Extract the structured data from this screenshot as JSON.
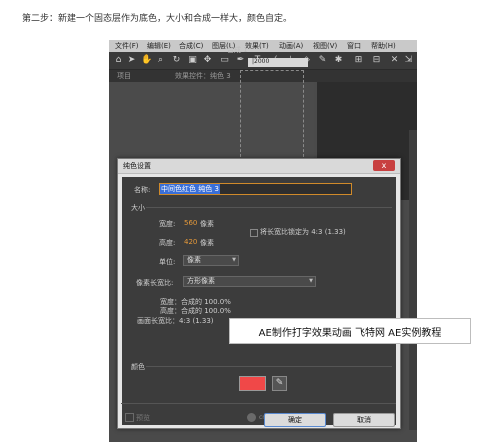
{
  "caption": "第二步：新建一个固态层作为底色，大小和合成一样大，颜色自定。",
  "menubar": {
    "items": [
      "文件(F)",
      "编辑(E)",
      "合成(C)",
      "图层(L)",
      "效果(T)",
      "动画(A)",
      "视图(V)",
      "窗口",
      "帮助(H)"
    ]
  },
  "panels": {
    "project_tab": "项目",
    "effects_tab": "效果控件：纯色 3",
    "comp_tab": "合成 1",
    "ruler_label": "|2000"
  },
  "dialog": {
    "title": "纯色设置",
    "close_label": "x",
    "name_label": "名称:",
    "name_value": "中间色红色 纯色 3",
    "size_section": "大小",
    "width_label": "宽度:",
    "width_value": "560",
    "width_unit": "像素",
    "height_label": "高度:",
    "height_value": "420",
    "height_unit": "像素",
    "lock_label": "将长宽比锁定为 4:3 (1.33)",
    "units_label": "单位:",
    "units_value": "像素",
    "pixel_aspect_label": "像素长宽比:",
    "pixel_aspect_value": "方形像素",
    "width_pct": "宽度：合成的 100.0%",
    "height_pct": "高度：合成的 100.0%",
    "frame_aspect": "画面长宽比：4:3 (1.33)",
    "make_comp_size": "制作合成大小",
    "color_section": "颜色",
    "color_value": "#f04848",
    "preview_label": "预览",
    "ok_label": "确定",
    "cancel_label": "取消"
  },
  "banner": {
    "text": "AE制作打字效果动画 飞特网 AE实例教程"
  },
  "watermark": {
    "text": "cn"
  }
}
